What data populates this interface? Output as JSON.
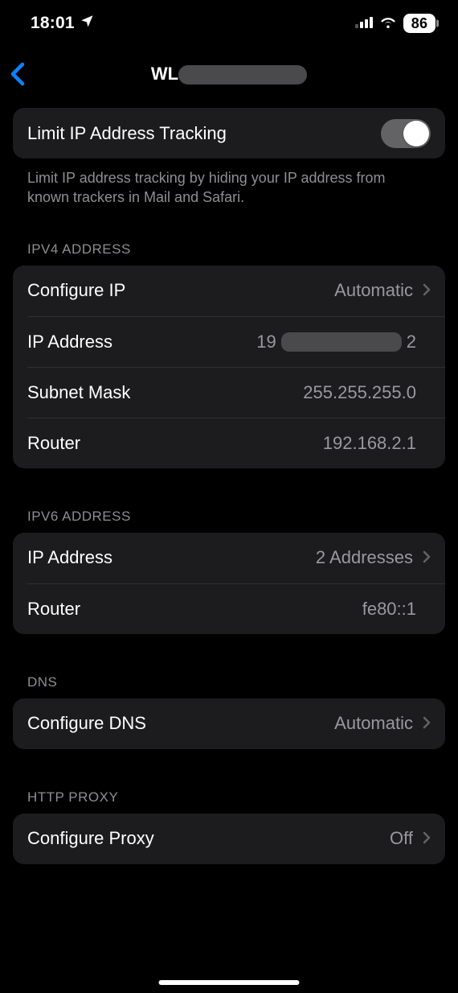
{
  "status": {
    "time": "18:01",
    "battery": "86"
  },
  "nav": {
    "title_prefix": "WL"
  },
  "limit_tracking": {
    "label": "Limit IP Address Tracking",
    "description": "Limit IP address tracking by hiding your IP address from known trackers in Mail and Safari.",
    "enabled": true
  },
  "ipv4": {
    "header": "IPV4 Address",
    "configure_label": "Configure IP",
    "configure_value": "Automatic",
    "ip_label": "IP Address",
    "ip_prefix": "19",
    "ip_suffix": "2",
    "ip_redacted": true,
    "subnet_label": "Subnet Mask",
    "subnet_value": "255.255.255.0",
    "router_label": "Router",
    "router_value": "192.168.2.1"
  },
  "ipv6": {
    "header": "IPV6 Address",
    "ip_label": "IP Address",
    "ip_value": "2 Addresses",
    "router_label": "Router",
    "router_value": "fe80::1"
  },
  "dns": {
    "header": "DNS",
    "configure_label": "Configure DNS",
    "configure_value": "Automatic"
  },
  "proxy": {
    "header": "HTTP Proxy",
    "configure_label": "Configure Proxy",
    "configure_value": "Off"
  }
}
